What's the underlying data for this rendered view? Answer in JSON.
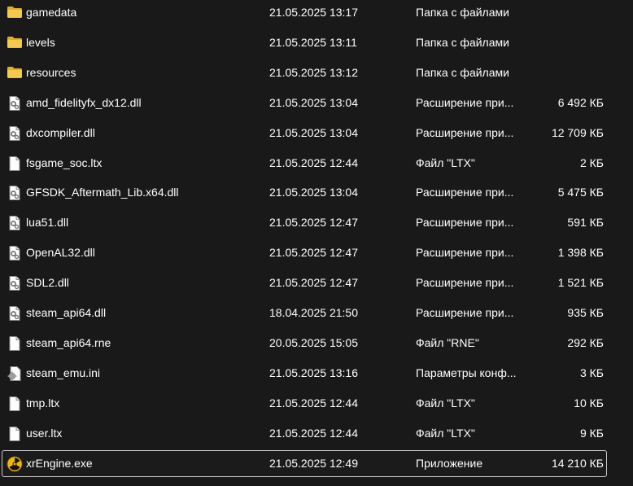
{
  "files": [
    {
      "name": "gamedata",
      "date": "21.05.2025 13:17",
      "type": "Папка с файлами",
      "size": "",
      "icon": "folder-icon"
    },
    {
      "name": "levels",
      "date": "21.05.2025 13:11",
      "type": "Папка с файлами",
      "size": "",
      "icon": "folder-icon"
    },
    {
      "name": "resources",
      "date": "21.05.2025 13:12",
      "type": "Папка с файлами",
      "size": "",
      "icon": "folder-icon"
    },
    {
      "name": "amd_fidelityfx_dx12.dll",
      "date": "21.05.2025 13:04",
      "type": "Расширение при...",
      "size": "6 492 КБ",
      "icon": "dll-file-icon"
    },
    {
      "name": "dxcompiler.dll",
      "date": "21.05.2025 13:04",
      "type": "Расширение при...",
      "size": "12 709 КБ",
      "icon": "dll-file-icon"
    },
    {
      "name": "fsgame_soc.ltx",
      "date": "21.05.2025 12:44",
      "type": "Файл \"LTX\"",
      "size": "2 КБ",
      "icon": "blank-file-icon"
    },
    {
      "name": "GFSDK_Aftermath_Lib.x64.dll",
      "date": "21.05.2025 13:04",
      "type": "Расширение при...",
      "size": "5 475 КБ",
      "icon": "dll-file-icon"
    },
    {
      "name": "lua51.dll",
      "date": "21.05.2025 12:47",
      "type": "Расширение при...",
      "size": "591 КБ",
      "icon": "dll-file-icon"
    },
    {
      "name": "OpenAL32.dll",
      "date": "21.05.2025 12:47",
      "type": "Расширение при...",
      "size": "1 398 КБ",
      "icon": "dll-file-icon"
    },
    {
      "name": "SDL2.dll",
      "date": "21.05.2025 12:47",
      "type": "Расширение при...",
      "size": "1 521 КБ",
      "icon": "dll-file-icon"
    },
    {
      "name": "steam_api64.dll",
      "date": "18.04.2025 21:50",
      "type": "Расширение при...",
      "size": "935 КБ",
      "icon": "dll-file-icon"
    },
    {
      "name": "steam_api64.rne",
      "date": "20.05.2025 15:05",
      "type": "Файл \"RNE\"",
      "size": "292 КБ",
      "icon": "blank-file-icon"
    },
    {
      "name": "steam_emu.ini",
      "date": "21.05.2025 13:16",
      "type": "Параметры конф...",
      "size": "3 КБ",
      "icon": "settings-file-icon"
    },
    {
      "name": "tmp.ltx",
      "date": "21.05.2025 12:44",
      "type": "Файл \"LTX\"",
      "size": "10 КБ",
      "icon": "blank-file-icon"
    },
    {
      "name": "user.ltx",
      "date": "21.05.2025 12:44",
      "type": "Файл \"LTX\"",
      "size": "9 КБ",
      "icon": "blank-file-icon"
    },
    {
      "name": "xrEngine.exe",
      "date": "21.05.2025 12:49",
      "type": "Приложение",
      "size": "14 210 КБ",
      "icon": "radiation-exe-icon",
      "selected": true
    }
  ],
  "colors": {
    "background": "#191919",
    "text": "#ffffff",
    "folder": "#f3c64b",
    "selection_border": "#c9c9c9"
  }
}
